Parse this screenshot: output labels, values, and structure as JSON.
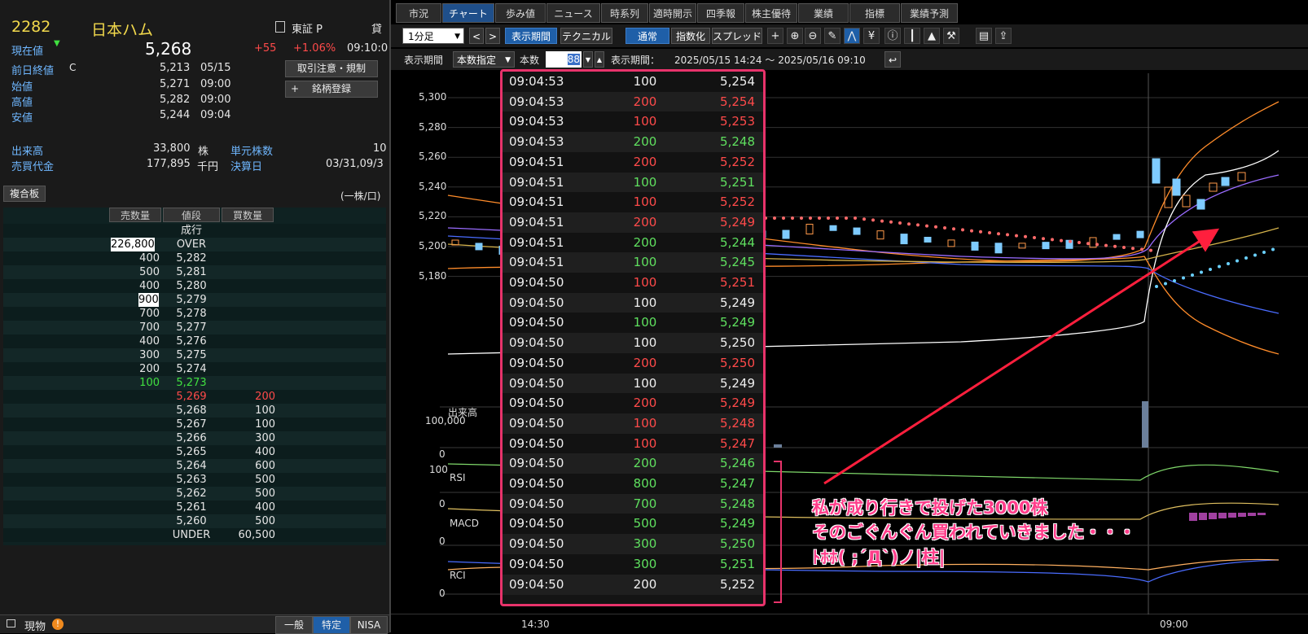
{
  "quote": {
    "code": "2282",
    "name": "日本ハム",
    "current_label": "現在値",
    "current_price": "5,268",
    "change": "+55",
    "change_pct": "+1.06%",
    "time": "09:10:0",
    "market": "東証 P",
    "market_extra": "貸",
    "prev_close_label": "前日終値",
    "prev_close_flag": "C",
    "prev_close_value": "5,213",
    "prev_close_date": "05/15",
    "open_label": "始値",
    "open_value": "5,271",
    "open_time": "09:00",
    "high_label": "高値",
    "high_value": "5,282",
    "high_time": "09:00",
    "low_label": "安値",
    "low_value": "5,244",
    "low_time": "09:04",
    "volume_label": "出来高",
    "volume_value": "33,800",
    "volume_unit": "株",
    "unit_shares_label": "単元株数",
    "unit_shares_value": "10",
    "turnover_label": "売買代金",
    "turnover_value": "177,895",
    "turnover_unit": "千円",
    "settlement_label": "決算日",
    "settlement_value": "03/31,09/3",
    "btn_caution": "取引注意・規制",
    "btn_register": "銘柄登録",
    "register_icon": "+"
  },
  "book": {
    "title": "複合板",
    "unit_note": "(一株/口)",
    "head_sell": "売数量",
    "head_price": "値段",
    "head_buy": "買数量",
    "rows": [
      {
        "sell": "",
        "price": "成行",
        "buy": ""
      },
      {
        "sell": "226,800",
        "price": "OVER",
        "buy": ""
      },
      {
        "sell": "400",
        "price": "5,282",
        "buy": ""
      },
      {
        "sell": "500",
        "price": "5,281",
        "buy": ""
      },
      {
        "sell": "400",
        "price": "5,280",
        "buy": ""
      },
      {
        "sell": "900",
        "price": "5,279",
        "buy": ""
      },
      {
        "sell": "700",
        "price": "5,278",
        "buy": ""
      },
      {
        "sell": "700",
        "price": "5,277",
        "buy": ""
      },
      {
        "sell": "400",
        "price": "5,276",
        "buy": ""
      },
      {
        "sell": "300",
        "price": "5,275",
        "buy": ""
      },
      {
        "sell": "200",
        "price": "5,274",
        "buy": ""
      },
      {
        "sell": "100",
        "price": "5,273",
        "buy": ""
      },
      {
        "sell": "",
        "price": "5,269",
        "buy": "200"
      },
      {
        "sell": "",
        "price": "5,268",
        "buy": "100"
      },
      {
        "sell": "",
        "price": "5,267",
        "buy": "100"
      },
      {
        "sell": "",
        "price": "5,266",
        "buy": "300"
      },
      {
        "sell": "",
        "price": "5,265",
        "buy": "400"
      },
      {
        "sell": "",
        "price": "5,264",
        "buy": "600"
      },
      {
        "sell": "",
        "price": "5,263",
        "buy": "500"
      },
      {
        "sell": "",
        "price": "5,262",
        "buy": "500"
      },
      {
        "sell": "",
        "price": "5,261",
        "buy": "400"
      },
      {
        "sell": "",
        "price": "5,260",
        "buy": "500"
      },
      {
        "sell": "",
        "price": "UNDER",
        "buy": "60,500"
      }
    ]
  },
  "bottom": {
    "label": "現物",
    "tab1": "一般",
    "tab2": "特定",
    "tab3": "NISA"
  },
  "tabs": [
    "市況",
    "チャート",
    "歩み値",
    "ニュース",
    "時系列",
    "適時開示",
    "四季報",
    "株主優待",
    "業績",
    "指標",
    "業績予測"
  ],
  "toolbar": {
    "interval": "1分足",
    "btn_period": "表示期間",
    "btn_technical": "テクニカル",
    "btn_normal": "通常",
    "btn_index": "指数化",
    "btn_spread": "スプレッド",
    "row2_label": "表示期間",
    "row2_select": "本数指定",
    "row2_count_label": "本数",
    "row2_count": "88",
    "row2_period_label": "表示期間：",
    "row2_period": "2025/05/15 14:24 ～ 2025/05/16 09:10"
  },
  "chart": {
    "y_ticks": [
      "5,300",
      "5,280",
      "5,260",
      "5,240",
      "5,220",
      "5,200",
      "5,180"
    ],
    "volume_label": "出来高",
    "volume_tick": "100,000",
    "volume_zero": "0",
    "rsi_label": "RSI",
    "rsi_top": "100",
    "rsi_zero": "0",
    "macd_label": "MACD",
    "macd_zero": "0",
    "rci_label": "RCI",
    "rci_zero": "0",
    "x_ticks": [
      "14:30",
      "09:00"
    ]
  },
  "trades": [
    {
      "time": "09:04:53",
      "qty": "100",
      "price": "5,254",
      "qc": "white",
      "pc": "white"
    },
    {
      "time": "09:04:53",
      "qty": "200",
      "price": "5,254",
      "qc": "red",
      "pc": "red"
    },
    {
      "time": "09:04:53",
      "qty": "100",
      "price": "5,253",
      "qc": "red",
      "pc": "red"
    },
    {
      "time": "09:04:53",
      "qty": "200",
      "price": "5,248",
      "qc": "green",
      "pc": "green"
    },
    {
      "time": "09:04:51",
      "qty": "200",
      "price": "5,252",
      "qc": "red",
      "pc": "red"
    },
    {
      "time": "09:04:51",
      "qty": "100",
      "price": "5,251",
      "qc": "green",
      "pc": "green"
    },
    {
      "time": "09:04:51",
      "qty": "100",
      "price": "5,252",
      "qc": "red",
      "pc": "red"
    },
    {
      "time": "09:04:51",
      "qty": "200",
      "price": "5,249",
      "qc": "red",
      "pc": "red"
    },
    {
      "time": "09:04:51",
      "qty": "200",
      "price": "5,244",
      "qc": "green",
      "pc": "green"
    },
    {
      "time": "09:04:51",
      "qty": "100",
      "price": "5,245",
      "qc": "green",
      "pc": "green"
    },
    {
      "time": "09:04:50",
      "qty": "100",
      "price": "5,251",
      "qc": "red",
      "pc": "red"
    },
    {
      "time": "09:04:50",
      "qty": "100",
      "price": "5,249",
      "qc": "white",
      "pc": "white"
    },
    {
      "time": "09:04:50",
      "qty": "100",
      "price": "5,249",
      "qc": "green",
      "pc": "green"
    },
    {
      "time": "09:04:50",
      "qty": "100",
      "price": "5,250",
      "qc": "white",
      "pc": "white"
    },
    {
      "time": "09:04:50",
      "qty": "200",
      "price": "5,250",
      "qc": "red",
      "pc": "red"
    },
    {
      "time": "09:04:50",
      "qty": "100",
      "price": "5,249",
      "qc": "white",
      "pc": "white"
    },
    {
      "time": "09:04:50",
      "qty": "200",
      "price": "5,249",
      "qc": "red",
      "pc": "red"
    },
    {
      "time": "09:04:50",
      "qty": "100",
      "price": "5,248",
      "qc": "red",
      "pc": "red"
    },
    {
      "time": "09:04:50",
      "qty": "100",
      "price": "5,247",
      "qc": "red",
      "pc": "red"
    },
    {
      "time": "09:04:50",
      "qty": "200",
      "price": "5,246",
      "qc": "green",
      "pc": "green"
    },
    {
      "time": "09:04:50",
      "qty": "800",
      "price": "5,247",
      "qc": "green",
      "pc": "green"
    },
    {
      "time": "09:04:50",
      "qty": "700",
      "price": "5,248",
      "qc": "green",
      "pc": "green"
    },
    {
      "time": "09:04:50",
      "qty": "500",
      "price": "5,249",
      "qc": "green",
      "pc": "green"
    },
    {
      "time": "09:04:50",
      "qty": "300",
      "price": "5,250",
      "qc": "green",
      "pc": "green"
    },
    {
      "time": "09:04:50",
      "qty": "300",
      "price": "5,251",
      "qc": "green",
      "pc": "green"
    },
    {
      "time": "09:04:50",
      "qty": "200",
      "price": "5,252",
      "qc": "white",
      "pc": "white"
    }
  ],
  "annotation": {
    "line1": "私が成り行きで投げた3000株",
    "line2": "そのごぐんぐん買われていきました・・・",
    "line3": "ﾄﾎﾎ( ;´Д`)ノ|柱|"
  },
  "colors": {
    "accent": "#1f5fa8",
    "up": "#ff4a4a",
    "down": "#5fe05f",
    "annotation": "#e8336b",
    "quote_title": "#f2d94c"
  }
}
